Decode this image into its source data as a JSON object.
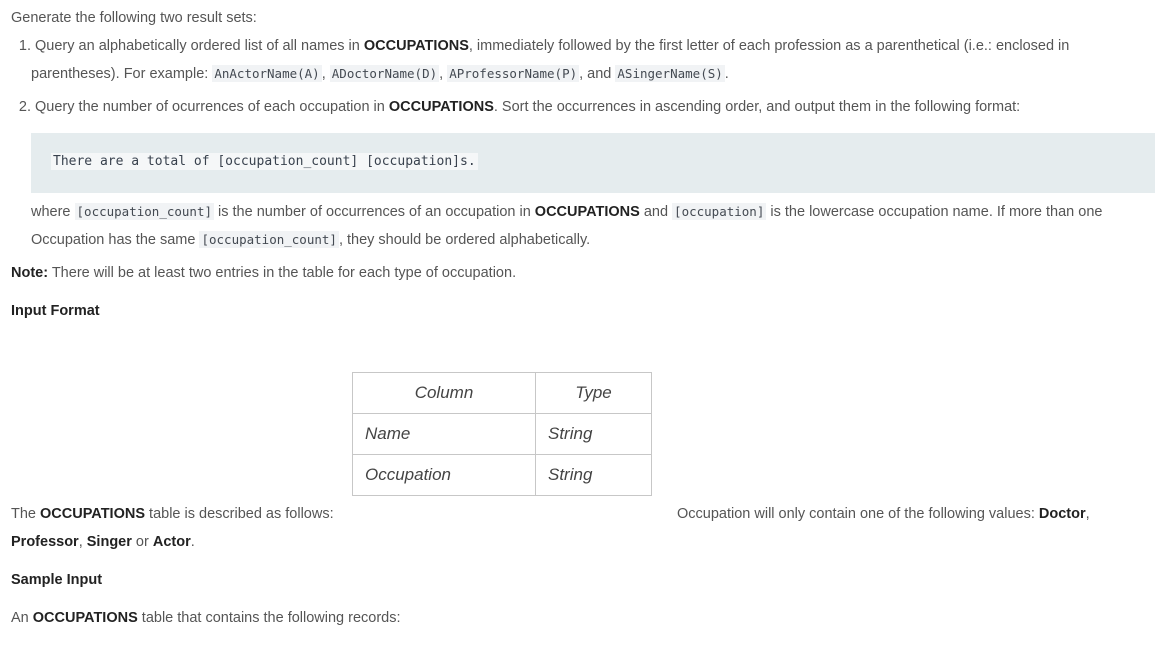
{
  "intro": "Generate the following two result sets:",
  "item1": {
    "num": "1.",
    "a": " Query an alphabetically ordered list of all names in ",
    "occ": "OCCUPATIONS",
    "b": ", immediately followed by the first letter of each profession as a parenthetical (i.e.: enclosed in",
    "c": "parentheses). For example: ",
    "ex1": "AnActorName(A)",
    "sep1": ", ",
    "ex2": "ADoctorName(D)",
    "sep2": ", ",
    "ex3": "AProfessorName(P)",
    "sep3": ", and ",
    "ex4": "ASingerName(S)",
    "end": "."
  },
  "item2": {
    "num": "2.",
    "a": " Query the number of ocurrences of each occupation in ",
    "occ": "OCCUPATIONS",
    "b": ". Sort the occurrences in ascending order, and output them in the following format:"
  },
  "code_block": "There are a total of [occupation_count] [occupation]s.",
  "where": {
    "a": "where ",
    "c1": "[occupation_count]",
    "b": " is the number of occurrences of an occupation in ",
    "occ": "OCCUPATIONS",
    "c": " and ",
    "c2": "[occupation]",
    "d": " is the lowercase occupation name. If more than one",
    "e": "Occupation has the same ",
    "c3": "[occupation_count]",
    "f": ", they should be ordered alphabetically."
  },
  "note": {
    "label": "Note:",
    "text": " There will be at least two entries in the table for each type of occupation."
  },
  "input_format_heading": "Input Format",
  "columns_table": {
    "headers": [
      "Column",
      "Type"
    ],
    "rows": [
      [
        "Name",
        "String"
      ],
      [
        "Occupation",
        "String"
      ]
    ]
  },
  "described": {
    "a": "The ",
    "occ": "OCCUPATIONS",
    "b": " table is described as follows:"
  },
  "values_line": {
    "a": "Occupation will only contain one of the following values: ",
    "v1": "Doctor",
    "s1": ",",
    "v2": "Professor",
    "s2": ", ",
    "v3": "Singer",
    "s3": " or ",
    "v4": "Actor",
    "end": "."
  },
  "sample_input_heading": "Sample Input",
  "sample_line": {
    "a": "An ",
    "occ": "OCCUPATIONS",
    "b": " table that contains the following records:"
  }
}
